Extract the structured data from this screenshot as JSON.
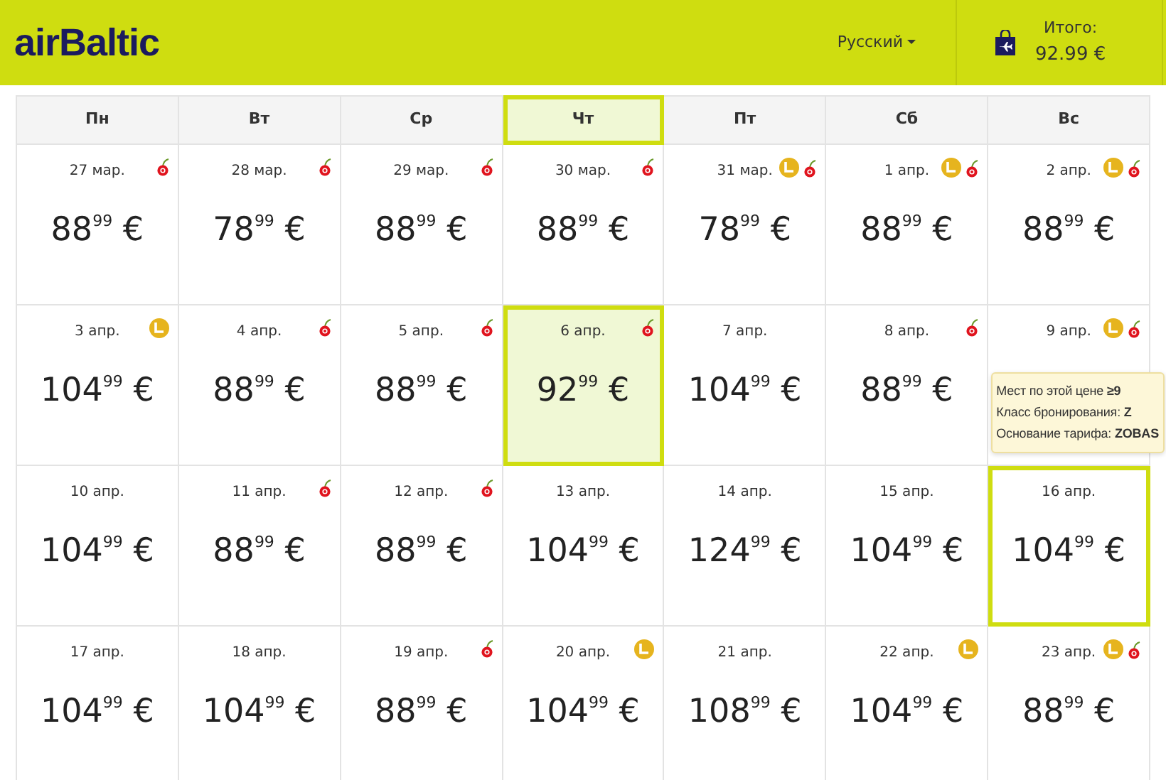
{
  "header": {
    "logo": "airBaltic",
    "language": "Русский",
    "total_label": "Итого:",
    "total": "92.99 €"
  },
  "weekdays": [
    {
      "label": "Пн",
      "selected": false
    },
    {
      "label": "Вт",
      "selected": false
    },
    {
      "label": "Ср",
      "selected": false
    },
    {
      "label": "Чт",
      "selected": true
    },
    {
      "label": "Пт",
      "selected": false
    },
    {
      "label": "Сб",
      "selected": false
    },
    {
      "label": "Вс",
      "selected": false
    }
  ],
  "weeks": [
    [
      {
        "date": "27 мар.",
        "price": "88",
        "cents": "99",
        "currency": "€",
        "seat": false,
        "cherry": true,
        "selected": false,
        "hovered": false
      },
      {
        "date": "28 мар.",
        "price": "78",
        "cents": "99",
        "currency": "€",
        "seat": false,
        "cherry": true,
        "selected": false,
        "hovered": false
      },
      {
        "date": "29 мар.",
        "price": "88",
        "cents": "99",
        "currency": "€",
        "seat": false,
        "cherry": true,
        "selected": false,
        "hovered": false
      },
      {
        "date": "30 мар.",
        "price": "88",
        "cents": "99",
        "currency": "€",
        "seat": false,
        "cherry": true,
        "selected": false,
        "hovered": false
      },
      {
        "date": "31 мар.",
        "price": "78",
        "cents": "99",
        "currency": "€",
        "seat": true,
        "cherry": true,
        "selected": false,
        "hovered": false
      },
      {
        "date": "1 апр.",
        "price": "88",
        "cents": "99",
        "currency": "€",
        "seat": true,
        "cherry": true,
        "selected": false,
        "hovered": false
      },
      {
        "date": "2 апр.",
        "price": "88",
        "cents": "99",
        "currency": "€",
        "seat": true,
        "cherry": true,
        "selected": false,
        "hovered": false
      }
    ],
    [
      {
        "date": "3 апр.",
        "price": "104",
        "cents": "99",
        "currency": "€",
        "seat": true,
        "cherry": false,
        "selected": false,
        "hovered": false
      },
      {
        "date": "4 апр.",
        "price": "88",
        "cents": "99",
        "currency": "€",
        "seat": false,
        "cherry": true,
        "selected": false,
        "hovered": false
      },
      {
        "date": "5 апр.",
        "price": "88",
        "cents": "99",
        "currency": "€",
        "seat": false,
        "cherry": true,
        "selected": false,
        "hovered": false
      },
      {
        "date": "6 апр.",
        "price": "92",
        "cents": "99",
        "currency": "€",
        "seat": false,
        "cherry": true,
        "selected": true,
        "hovered": false
      },
      {
        "date": "7 апр.",
        "price": "104",
        "cents": "99",
        "currency": "€",
        "seat": false,
        "cherry": false,
        "selected": false,
        "hovered": false
      },
      {
        "date": "8 апр.",
        "price": "88",
        "cents": "99",
        "currency": "€",
        "seat": false,
        "cherry": true,
        "selected": false,
        "hovered": false
      },
      {
        "date": "9 апр.",
        "seat": true,
        "cherry": true,
        "selected": false,
        "hovered": false
      }
    ],
    [
      {
        "date": "10 апр.",
        "price": "104",
        "cents": "99",
        "currency": "€",
        "seat": false,
        "cherry": false,
        "selected": false,
        "hovered": false
      },
      {
        "date": "11 апр.",
        "price": "88",
        "cents": "99",
        "currency": "€",
        "seat": false,
        "cherry": true,
        "selected": false,
        "hovered": false
      },
      {
        "date": "12 апр.",
        "price": "88",
        "cents": "99",
        "currency": "€",
        "seat": false,
        "cherry": true,
        "selected": false,
        "hovered": false
      },
      {
        "date": "13 апр.",
        "price": "104",
        "cents": "99",
        "currency": "€",
        "seat": false,
        "cherry": false,
        "selected": false,
        "hovered": false
      },
      {
        "date": "14 апр.",
        "price": "124",
        "cents": "99",
        "currency": "€",
        "seat": false,
        "cherry": false,
        "selected": false,
        "hovered": false
      },
      {
        "date": "15 апр.",
        "price": "104",
        "cents": "99",
        "currency": "€",
        "seat": false,
        "cherry": false,
        "selected": false,
        "hovered": false
      },
      {
        "date": "16 апр.",
        "price": "104",
        "cents": "99",
        "currency": "€",
        "seat": false,
        "cherry": false,
        "selected": false,
        "hovered": true
      }
    ],
    [
      {
        "date": "17 апр.",
        "price": "104",
        "cents": "99",
        "currency": "€",
        "seat": false,
        "cherry": false,
        "selected": false,
        "hovered": false
      },
      {
        "date": "18 апр.",
        "price": "104",
        "cents": "99",
        "currency": "€",
        "seat": false,
        "cherry": false,
        "selected": false,
        "hovered": false
      },
      {
        "date": "19 апр.",
        "price": "88",
        "cents": "99",
        "currency": "€",
        "seat": false,
        "cherry": true,
        "selected": false,
        "hovered": false
      },
      {
        "date": "20 апр.",
        "price": "104",
        "cents": "99",
        "currency": "€",
        "seat": true,
        "cherry": false,
        "selected": false,
        "hovered": false
      },
      {
        "date": "21 апр.",
        "price": "108",
        "cents": "99",
        "currency": "€",
        "seat": false,
        "cherry": false,
        "selected": false,
        "hovered": false
      },
      {
        "date": "22 апр.",
        "price": "104",
        "cents": "99",
        "currency": "€",
        "seat": true,
        "cherry": false,
        "selected": false,
        "hovered": false
      },
      {
        "date": "23 апр.",
        "price": "88",
        "cents": "99",
        "currency": "€",
        "seat": true,
        "cherry": true,
        "selected": false,
        "hovered": false
      }
    ]
  ],
  "tooltip": {
    "lines": [
      "Мест по этой цене **≥9**",
      "Класс бронирования: **Z**",
      "Основание тарифа: **ZOBAS**"
    ]
  }
}
